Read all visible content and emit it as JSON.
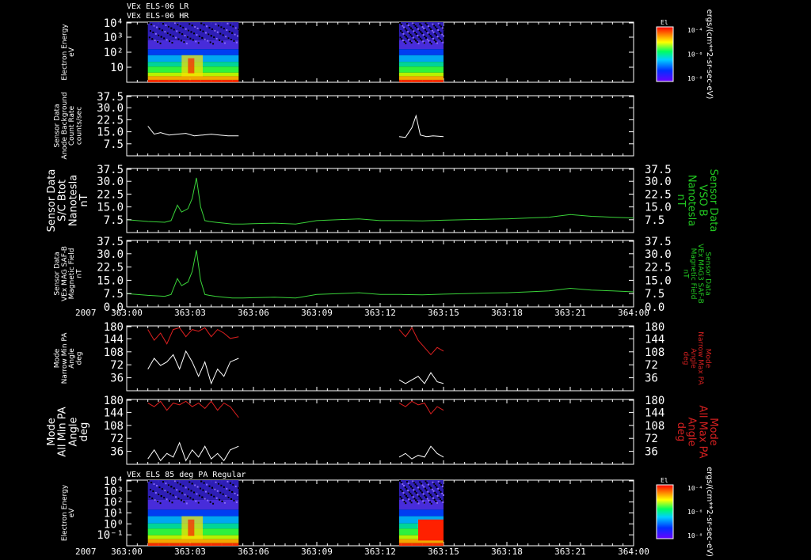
{
  "header": {
    "title_line1": "VEx ELS-06 LR",
    "title_line2": "VEx ELS-06 HR",
    "bottom_title": "VEx ELS 85 deg PA Regular"
  },
  "colorbars": [
    {
      "label": "El",
      "ticks": [
        "10⁻⁴",
        "10⁻⁶",
        "10⁻⁸"
      ],
      "units": "ergs/(cm**2-sr-sec-eV)"
    },
    {
      "label": "El",
      "ticks": [
        "10⁻⁴",
        "10⁻⁶",
        "10⁻⁸"
      ],
      "units": "ergs/(cm**2-sr-sec-eV)"
    }
  ],
  "time_axis": {
    "year": "2007",
    "labels": [
      "363:00",
      "363:03",
      "363:06",
      "363:09",
      "363:12",
      "363:15",
      "363:18",
      "363:21",
      "364:00"
    ]
  },
  "colors": {
    "white": "#ffffff",
    "green": "#39d339",
    "red": "#e02020",
    "text_green": "#22c922",
    "text_red": "#d42020"
  },
  "chart_data": [
    {
      "type": "heatmap",
      "name": "els_lr_hr_spectrogram",
      "ylabel": "Electron Energy\neV",
      "yticks": [
        "10⁴",
        "10³",
        "10²",
        "10"
      ],
      "scale": "log",
      "data_intervals_hours": [
        [
          1.0,
          5.3
        ],
        [
          12.9,
          15.0
        ]
      ],
      "colorbar_label": "El"
    },
    {
      "type": "line",
      "name": "anode_background",
      "ylabel": "Sensor Data\nAnode Background\nCount Rate\ncounts/sec",
      "yticks": [
        "37.5",
        "30.0",
        "22.5",
        "15.0",
        "7.5"
      ],
      "ylim": [
        0,
        37.5
      ],
      "series": [
        {
          "color": "white",
          "x": [
            1.0,
            1.3,
            1.6,
            2.0,
            2.4,
            2.8,
            3.2,
            3.6,
            4.0,
            4.4,
            4.8,
            5.3
          ],
          "y": [
            18.5,
            13.5,
            14.5,
            13.0,
            13.5,
            14.0,
            12.5,
            13.0,
            13.5,
            13.0,
            12.5,
            12.5
          ]
        },
        {
          "color": "white",
          "x": [
            12.9,
            13.2,
            13.5,
            13.7,
            13.9,
            14.2,
            14.5,
            15.0
          ],
          "y": [
            12.0,
            11.5,
            17.5,
            25.0,
            13.0,
            12.0,
            12.5,
            12.0
          ]
        }
      ]
    },
    {
      "type": "line",
      "name": "sc_bmag_vso",
      "ylabel": "Sensor Data\nS/C Btot\nNanotesla\nnT",
      "right_label": "Sensor Data\nVSO B\nNanotesla\nnT",
      "yticks": [
        "37.5",
        "30.0",
        "22.5",
        "15.0",
        "7.5"
      ],
      "ylim": [
        0,
        37.5
      ],
      "series": [
        {
          "color": "green",
          "x": [
            0,
            1.0,
            1.8,
            2.1,
            2.4,
            2.6,
            2.9,
            3.1,
            3.3,
            3.5,
            3.7,
            3.9,
            4.2,
            4.6,
            5.0,
            5.5,
            6.0,
            7.0,
            8.0,
            9.0,
            10.0,
            11.0,
            12.0,
            13.0,
            14.0,
            15.0,
            16.0,
            17.0,
            18.0,
            19.0,
            20.0,
            21.0,
            22.0,
            23.0,
            24.0
          ],
          "y": [
            7.5,
            6.5,
            6.0,
            7.0,
            16.0,
            12.0,
            14.0,
            20.0,
            32.0,
            15.0,
            7.0,
            6.5,
            6.0,
            5.5,
            5.0,
            5.0,
            5.2,
            5.5,
            5.0,
            7.0,
            7.5,
            8.0,
            7.0,
            7.0,
            6.8,
            7.2,
            7.5,
            7.8,
            8.0,
            8.5,
            9.0,
            10.5,
            9.5,
            9.0,
            8.5
          ]
        }
      ]
    },
    {
      "type": "line",
      "name": "mag3_saf_b",
      "ylabel": "Sensor Data\nVEx MAG SAF-B\nMagnetic Field\nnT",
      "right_label": "Sensor Data\nVEx MAG3 SAF-B\nMagnetic Field\nnT",
      "yticks": [
        "37.5",
        "30.0",
        "22.5",
        "15.0",
        "7.5",
        "0.0"
      ],
      "ylim": [
        0,
        37.5
      ],
      "series": [
        {
          "color": "green",
          "x": [
            0,
            1.0,
            1.8,
            2.1,
            2.4,
            2.6,
            2.9,
            3.1,
            3.3,
            3.5,
            3.7,
            3.9,
            4.2,
            4.6,
            5.0,
            5.5,
            6.0,
            7.0,
            8.0,
            9.0,
            10.0,
            11.0,
            12.0,
            13.0,
            14.0,
            15.0,
            16.0,
            17.0,
            18.0,
            19.0,
            20.0,
            21.0,
            22.0,
            23.0,
            24.0
          ],
          "y": [
            7.5,
            6.5,
            6.0,
            7.0,
            16.0,
            12.0,
            14.0,
            20.0,
            32.0,
            15.0,
            7.0,
            6.5,
            6.0,
            5.5,
            5.0,
            5.0,
            5.2,
            5.5,
            5.0,
            7.0,
            7.5,
            8.0,
            7.0,
            7.0,
            6.8,
            7.2,
            7.5,
            7.8,
            8.0,
            8.5,
            9.0,
            10.5,
            9.5,
            9.0,
            8.5
          ]
        }
      ]
    },
    {
      "type": "line",
      "name": "narrow_mode_pa",
      "ylabel": "Mode\nNarrow Min PA\nAngle\ndeg",
      "right_label": "Mode\nNarrow Max PA\nAngle\ndeg",
      "yticks": [
        "180",
        "144",
        "108",
        "72",
        "36"
      ],
      "ylim": [
        0,
        180
      ],
      "series": [
        {
          "color": "red",
          "x": [
            1.0,
            1.3,
            1.6,
            1.9,
            2.2,
            2.5,
            2.8,
            3.1,
            3.4,
            3.7,
            4.0,
            4.3,
            4.6,
            4.9,
            5.3
          ],
          "y": [
            170,
            140,
            160,
            130,
            170,
            175,
            150,
            170,
            165,
            175,
            150,
            170,
            160,
            145,
            150
          ]
        },
        {
          "color": "white",
          "x": [
            1.0,
            1.3,
            1.6,
            1.9,
            2.2,
            2.5,
            2.8,
            3.1,
            3.4,
            3.7,
            4.0,
            4.3,
            4.6,
            4.9,
            5.3
          ],
          "y": [
            60,
            90,
            70,
            80,
            100,
            60,
            110,
            80,
            40,
            80,
            20,
            60,
            40,
            80,
            90
          ]
        },
        {
          "color": "red",
          "x": [
            12.9,
            13.2,
            13.5,
            13.8,
            14.1,
            14.4,
            14.7,
            15.0
          ],
          "y": [
            170,
            150,
            175,
            140,
            120,
            100,
            120,
            110
          ]
        },
        {
          "color": "white",
          "x": [
            12.9,
            13.2,
            13.5,
            13.8,
            14.1,
            14.4,
            14.7,
            15.0
          ],
          "y": [
            30,
            20,
            30,
            40,
            20,
            50,
            25,
            20
          ]
        }
      ]
    },
    {
      "type": "line",
      "name": "all_mode_pa",
      "ylabel": "Mode\nAll Min PA\nAngle\ndeg",
      "right_label": "Mode\nAll Max PA\nAngle\ndeg",
      "yticks": [
        "180",
        "144",
        "108",
        "72",
        "36"
      ],
      "ylim": [
        0,
        180
      ],
      "series": [
        {
          "color": "red",
          "x": [
            1.0,
            1.3,
            1.6,
            1.9,
            2.2,
            2.5,
            2.8,
            3.1,
            3.4,
            3.7,
            4.0,
            4.3,
            4.6,
            4.9,
            5.3
          ],
          "y": [
            170,
            160,
            175,
            150,
            170,
            165,
            175,
            160,
            170,
            155,
            175,
            150,
            170,
            160,
            130
          ]
        },
        {
          "color": "white",
          "x": [
            1.0,
            1.3,
            1.6,
            1.9,
            2.2,
            2.5,
            2.8,
            3.1,
            3.4,
            3.7,
            4.0,
            4.3,
            4.6,
            4.9,
            5.3
          ],
          "y": [
            15,
            40,
            10,
            30,
            20,
            60,
            10,
            40,
            20,
            50,
            15,
            30,
            10,
            40,
            50
          ]
        },
        {
          "color": "red",
          "x": [
            12.9,
            13.2,
            13.5,
            13.8,
            14.1,
            14.4,
            14.7,
            15.0
          ],
          "y": [
            170,
            160,
            175,
            165,
            170,
            140,
            160,
            150
          ]
        },
        {
          "color": "white",
          "x": [
            12.9,
            13.2,
            13.5,
            13.8,
            14.1,
            14.4,
            14.7,
            15.0
          ],
          "y": [
            20,
            30,
            15,
            25,
            20,
            50,
            30,
            20
          ]
        }
      ]
    },
    {
      "type": "heatmap",
      "name": "els_85deg_pa",
      "ylabel": "Electron Energy\neV",
      "yticks": [
        "10⁴",
        "10³",
        "10²",
        "10¹",
        "10⁰",
        "10⁻¹"
      ],
      "scale": "log",
      "data_intervals_hours": [
        [
          1.0,
          5.3
        ],
        [
          12.9,
          15.0
        ]
      ],
      "colorbar_label": "El"
    }
  ]
}
